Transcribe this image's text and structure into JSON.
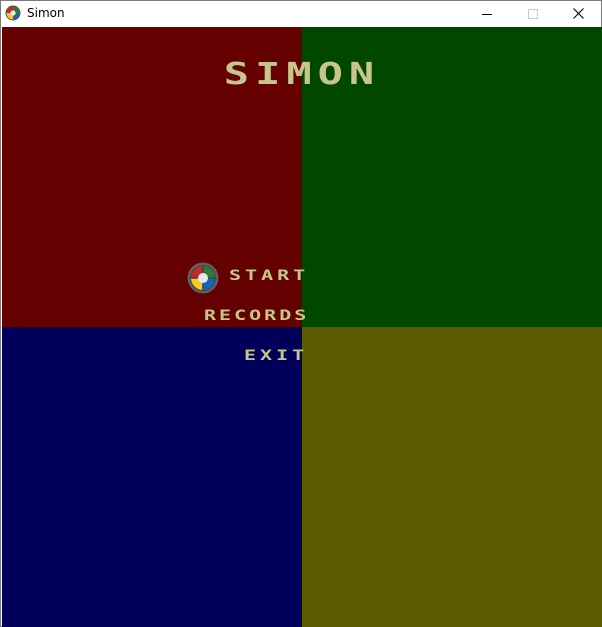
{
  "window": {
    "title": "Simon",
    "app_icon": "simon-app-icon",
    "controls": {
      "minimize_icon": "minimize-icon",
      "maximize_icon": "maximize-icon",
      "close_icon": "close-icon"
    }
  },
  "game": {
    "title": "SIMON",
    "colors": {
      "red": "#640000",
      "green": "#004800",
      "blue": "#00005a",
      "yellow": "#5a5a00",
      "text": "#c8c58a"
    },
    "menu": {
      "items": [
        "START",
        "RECORDS",
        "EXIT"
      ],
      "selected_index": 0,
      "selector_icon": "simon-selector-icon"
    }
  }
}
